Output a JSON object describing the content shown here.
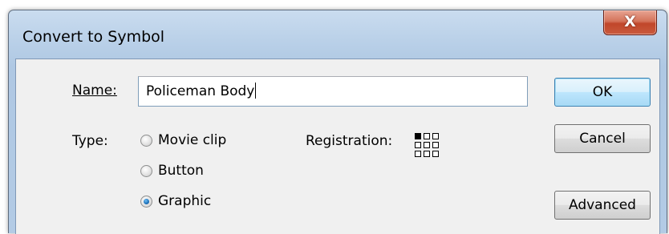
{
  "dialog": {
    "title": "Convert to Symbol",
    "close_label": "X"
  },
  "form": {
    "name_label": "Name:",
    "name_value": "Policeman Body",
    "type_label": "Type:",
    "type_options": [
      {
        "label": "Movie clip",
        "checked": false
      },
      {
        "label": "Button",
        "checked": false
      },
      {
        "label": "Graphic",
        "checked": true
      }
    ],
    "registration_label": "Registration:",
    "registration_selected": "top-left"
  },
  "buttons": {
    "ok": "OK",
    "cancel": "Cancel",
    "advanced": "Advanced"
  }
}
